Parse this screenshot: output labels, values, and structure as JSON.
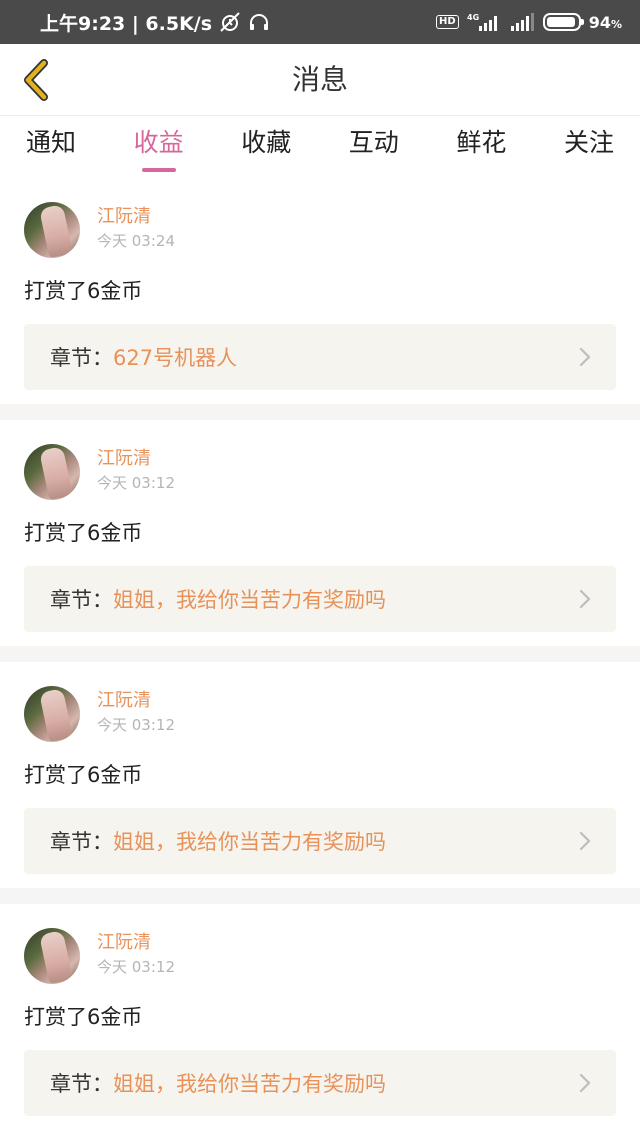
{
  "status_bar": {
    "time_speed": "上午9:23 | 6.5K/s",
    "hd": "HD",
    "network": "4G",
    "battery": "94",
    "battery_unit": "%",
    "battery_level": 0.94
  },
  "header": {
    "back_icon": "chevron-left-icon",
    "title": "消息",
    "accent_color": "#e0b220"
  },
  "tabs": [
    {
      "label": "通知"
    },
    {
      "label": "收益",
      "active": true
    },
    {
      "label": "收藏"
    },
    {
      "label": "互动"
    },
    {
      "label": "鲜花"
    },
    {
      "label": "关注"
    }
  ],
  "messages": [
    {
      "username": "江阮清",
      "time": "今天 03:24",
      "action": "打赏了6金币",
      "chapter_prefix": "章节：",
      "chapter_title": "627号机器人"
    },
    {
      "username": "江阮清",
      "time": "今天 03:12",
      "action": "打赏了6金币",
      "chapter_prefix": "章节：",
      "chapter_title": "姐姐，我给你当苦力有奖励吗"
    },
    {
      "username": "江阮清",
      "time": "今天 03:12",
      "action": "打赏了6金币",
      "chapter_prefix": "章节：",
      "chapter_title": "姐姐，我给你当苦力有奖励吗"
    },
    {
      "username": "江阮清",
      "time": "今天 03:12",
      "action": "打赏了6金币",
      "chapter_prefix": "章节：",
      "chapter_title": "姐姐，我给你当苦力有奖励吗"
    }
  ],
  "colors": {
    "active_tab": "#d6679b",
    "username": "#e8925a",
    "chapter_title": "#e8925a"
  }
}
